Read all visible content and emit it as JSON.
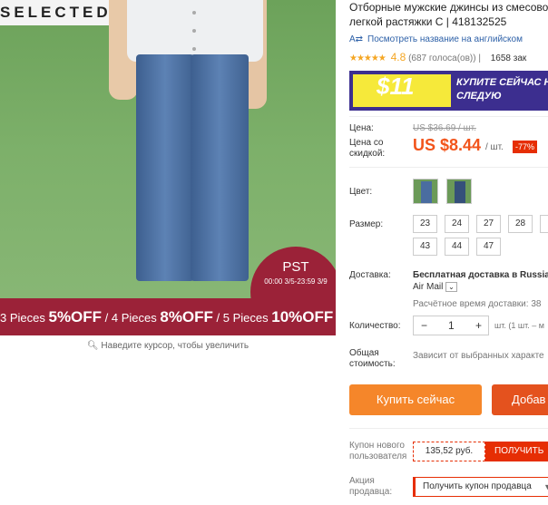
{
  "gallery": {
    "brand": "SELECTED",
    "pst_title": "PST",
    "pst_dates": "00:00 3/5-23:59 3/9",
    "promo": {
      "p1": "3 Pieces ",
      "p1b": "5%OFF",
      "p2": " / 4 Pieces ",
      "p2b": "8%OFF",
      "p3": " / 5 Pieces ",
      "p3b": "10%OFF"
    },
    "zoom_hint": "Наведите курсор, чтобы увеличить"
  },
  "product": {
    "title_line1": "Отборные мужские джинсы из смесово",
    "title_line2": "легкой растяжки C | 418132525",
    "translate_link": "Посмотреть название на английском",
    "rating_value": "4.8",
    "votes": "(687 голоса(ов))",
    "orders": "1658 зак",
    "banner_amount": "$11",
    "banner_text": "КУПИТЕ СЕЙЧАС НА СЛЕДУЮ"
  },
  "price": {
    "label": "Цена:",
    "old": "US $36.69 / шт.",
    "discount_label": "Цена со скидкой:",
    "new": "US $8.44",
    "per_unit": "/ шт.",
    "discount_pct": "-77%"
  },
  "color": {
    "label": "Цвет:"
  },
  "size": {
    "label": "Размер:",
    "options": [
      "23",
      "24",
      "27",
      "28",
      "43",
      "44",
      "47"
    ]
  },
  "shipping": {
    "label": "Доставка:",
    "value": "Бесплатная доставка в Russia",
    "value2": "Air Mail",
    "time": "Расчётное время доставки: 38"
  },
  "quantity": {
    "label": "Количество:",
    "minus": "−",
    "value": "1",
    "plus": "+",
    "unit": "шт. (1 шт. – м"
  },
  "total": {
    "label_line1": "Общая",
    "label_line2": "стоимость:",
    "value": "Зависит от выбранных характе"
  },
  "actions": {
    "buy_now": "Купить сейчас",
    "add_to_cart": "Добав"
  },
  "coupon": {
    "label_line1": "Купон нового",
    "label_line2": "пользователя",
    "amount": "135,52 руб.",
    "get_button": "ПОЛУЧИТЬ"
  },
  "seller": {
    "label_line1": "Акция",
    "label_line2": "продавца:",
    "select_value": "Получить купон продавца"
  },
  "colors": {
    "price_orange": "#f2541b",
    "buy_orange": "#f5862a",
    "cart_red": "#e4521e",
    "promo_maroon": "#9b2238",
    "banner_purple": "#3c2e8f",
    "banner_yellow": "#f6e93a",
    "link_blue": "#2e61a8"
  }
}
